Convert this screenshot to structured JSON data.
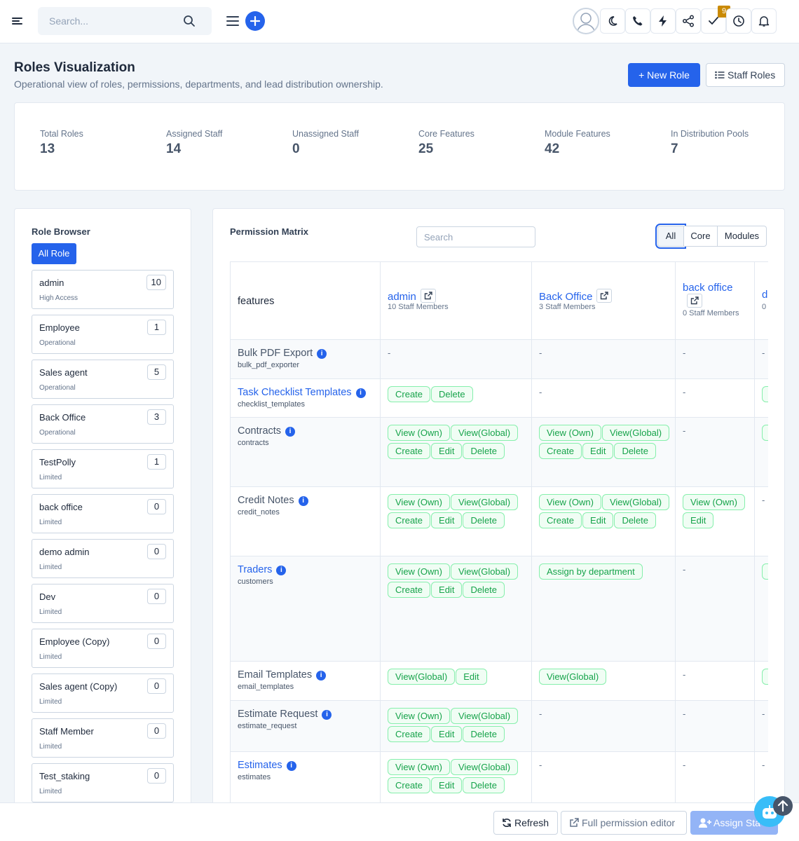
{
  "topbar": {
    "search_placeholder": "Search...",
    "notification_count": "9",
    "icons": [
      "menu-icon",
      "search-icon",
      "list-icon",
      "plus-icon",
      "avatar",
      "moon-icon",
      "phone-icon",
      "bolt-icon",
      "share-icon",
      "check-icon",
      "clock-icon",
      "bell-icon"
    ]
  },
  "header": {
    "title": "Roles Visualization",
    "subtitle": "Operational view of roles, permissions, departments, and lead distribution ownership.",
    "new_role": "+ New Role",
    "staff_roles": "Staff Roles"
  },
  "stats": [
    {
      "label": "Total Roles",
      "value": "13"
    },
    {
      "label": "Assigned Staff",
      "value": "14"
    },
    {
      "label": "Unassigned Staff",
      "value": "0"
    },
    {
      "label": "Core Features",
      "value": "25"
    },
    {
      "label": "Module Features",
      "value": "42"
    },
    {
      "label": "In Distribution Pools",
      "value": "7"
    }
  ],
  "browser": {
    "title": "Role Browser",
    "all_role": "All Role",
    "roles": [
      {
        "name": "admin",
        "level": "High Access",
        "count": "10"
      },
      {
        "name": "Employee",
        "level": "Operational",
        "count": "1"
      },
      {
        "name": "Sales agent",
        "level": "Operational",
        "count": "5"
      },
      {
        "name": "Back Office",
        "level": "Operational",
        "count": "3"
      },
      {
        "name": "TestPolly",
        "level": "Limited",
        "count": "1"
      },
      {
        "name": "back office",
        "level": "Limited",
        "count": "0"
      },
      {
        "name": "demo admin",
        "level": "Limited",
        "count": "0"
      },
      {
        "name": "Dev",
        "level": "Limited",
        "count": "0"
      },
      {
        "name": "Employee (Copy)",
        "level": "Limited",
        "count": "0"
      },
      {
        "name": "Sales agent (Copy)",
        "level": "Limited",
        "count": "0"
      },
      {
        "name": "Staff Member",
        "level": "Limited",
        "count": "0"
      },
      {
        "name": "Test_staking",
        "level": "Limited",
        "count": "0"
      }
    ]
  },
  "matrix": {
    "title": "Permission Matrix",
    "search_placeholder": "Search",
    "filters": {
      "all": "All",
      "core": "Core",
      "modules": "Modules"
    },
    "features_header": "features",
    "columns": [
      {
        "name": "admin",
        "count": "10 Staff Members"
      },
      {
        "name": "Back Office",
        "count": "3 Staff Members"
      },
      {
        "name": "back office",
        "count": "0 Staff Members"
      },
      {
        "name": "d",
        "count": "0"
      }
    ],
    "rows": [
      {
        "name": "Bulk PDF Export",
        "slug": "bulk_pdf_exporter",
        "link": false,
        "perms": [
          [],
          [],
          []
        ],
        "last": "dash"
      },
      {
        "name": "Task Checklist Templates",
        "slug": "checklist_templates",
        "link": true,
        "perms": [
          [
            "Create",
            "Delete"
          ],
          [],
          []
        ],
        "last": "chip"
      },
      {
        "name": "Contracts",
        "slug": "contracts",
        "link": false,
        "perms": [
          [
            "View (Own)",
            "View(Global)",
            "Create",
            "Edit",
            "Delete"
          ],
          [
            "View (Own)",
            "View(Global)",
            "Create",
            "Edit",
            "Delete"
          ],
          []
        ],
        "last": "chip"
      },
      {
        "name": "Credit Notes",
        "slug": "credit_notes",
        "link": false,
        "perms": [
          [
            "View (Own)",
            "View(Global)",
            "Create",
            "Edit",
            "Delete"
          ],
          [
            "View (Own)",
            "View(Global)",
            "Create",
            "Edit",
            "Delete"
          ],
          [
            "View (Own)",
            "Edit"
          ]
        ],
        "last": "dash"
      },
      {
        "name": "Traders",
        "slug": "customers",
        "link": true,
        "perms": [
          [
            "View (Own)",
            "View(Global)",
            "Create",
            "Edit",
            "Delete"
          ],
          [
            "Assign by department"
          ],
          []
        ],
        "last": "chip"
      },
      {
        "name": "Email Templates",
        "slug": "email_templates",
        "link": false,
        "perms": [
          [
            "View(Global)",
            "Edit"
          ],
          [
            "View(Global)"
          ],
          []
        ],
        "last": "chip"
      },
      {
        "name": "Estimate Request",
        "slug": "estimate_request",
        "link": false,
        "perms": [
          [
            "View (Own)",
            "View(Global)",
            "Create",
            "Edit",
            "Delete"
          ],
          [],
          []
        ],
        "last": "dash"
      },
      {
        "name": "Estimates",
        "slug": "estimates",
        "link": true,
        "perms": [
          [
            "View (Own)",
            "View(Global)",
            "Create",
            "Edit",
            "Delete"
          ],
          [],
          []
        ],
        "last": "dash"
      }
    ]
  },
  "bottombar": {
    "refresh": "Refresh",
    "full_editor": "Full permission editor",
    "assign": "Assign Sta"
  },
  "colors": {
    "accent": "#2563eb",
    "chip_green": "#16a34a",
    "chip_bg": "#f0fdf4",
    "badge": "#ca8a04"
  }
}
